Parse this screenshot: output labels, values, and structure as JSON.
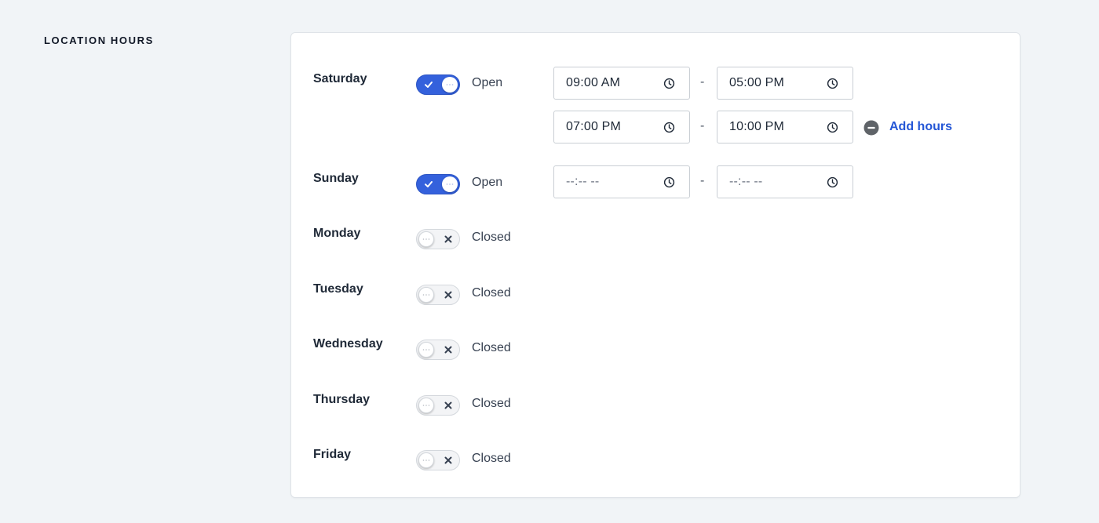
{
  "section": {
    "title": "LOCATION HOURS"
  },
  "colors": {
    "accent": "#3461dc",
    "link": "#2557d6",
    "background": "#f1f4f7"
  },
  "days": [
    {
      "name": "Saturday",
      "status": "Open",
      "open": true,
      "ranges": [
        {
          "start": "09:00 AM",
          "end": "05:00 PM"
        },
        {
          "start": "07:00 PM",
          "end": "10:00 PM"
        }
      ]
    },
    {
      "name": "Sunday",
      "status": "Open",
      "open": true,
      "ranges": [
        {
          "start": "--:-- --",
          "end": "--:-- --"
        }
      ]
    },
    {
      "name": "Monday",
      "status": "Closed",
      "open": false
    },
    {
      "name": "Tuesday",
      "status": "Closed",
      "open": false
    },
    {
      "name": "Wednesday",
      "status": "Closed",
      "open": false
    },
    {
      "name": "Thursday",
      "status": "Closed",
      "open": false
    },
    {
      "name": "Friday",
      "status": "Closed",
      "open": false
    }
  ],
  "separator": "-",
  "actions": {
    "add_hours_label": "Add hours"
  },
  "icons": {
    "clock": "clock-icon",
    "remove": "minus-circle-icon",
    "check": "check-icon",
    "close": "x-icon"
  }
}
